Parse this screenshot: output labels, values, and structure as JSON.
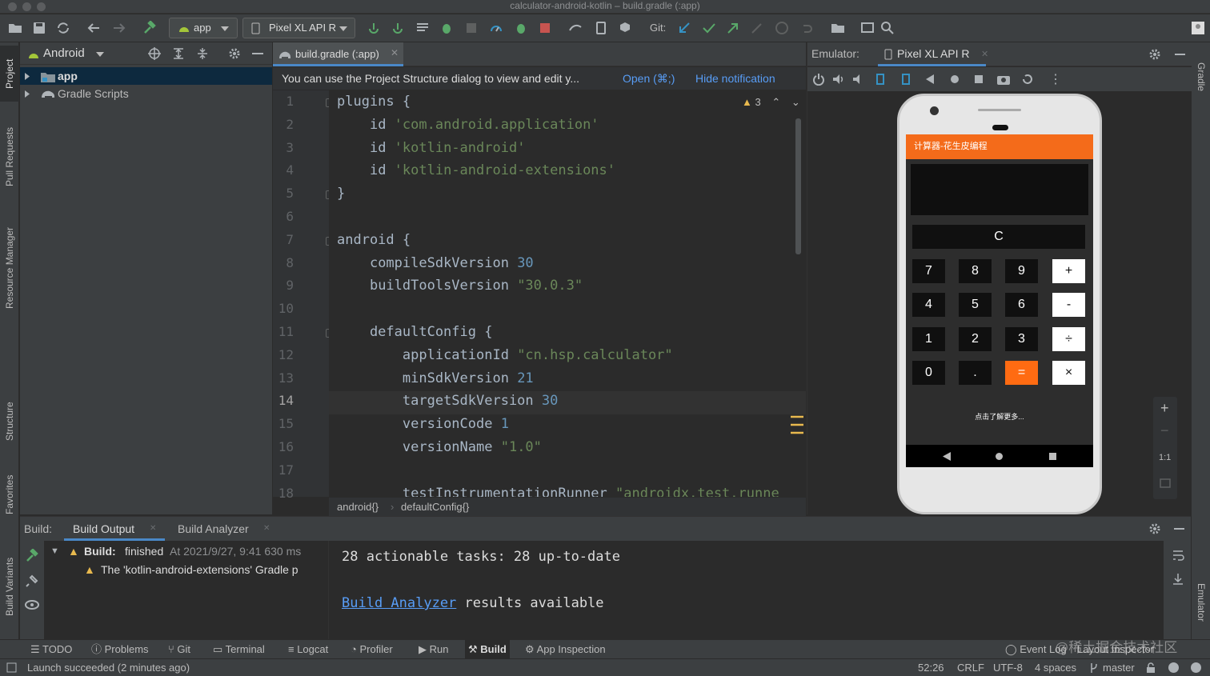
{
  "window": {
    "title": "calculator-android-kotlin – build.gradle (:app)"
  },
  "toolbar": {
    "run_config": "app",
    "device": "Pixel XL API R",
    "git_label": "Git:"
  },
  "project": {
    "view_mode": "Android",
    "tree": [
      {
        "label": "app"
      },
      {
        "label": "Gradle Scripts"
      }
    ]
  },
  "left_strip": [
    "Project",
    "Pull Requests",
    "Resource Manager",
    "Structure",
    "Favorites",
    "Build Variants"
  ],
  "right_strip": [
    "Gradle",
    "Emulator"
  ],
  "editor": {
    "tab": "build.gradle (:app)",
    "notification": "You can use the Project Structure dialog to view and edit y...",
    "notif_open": "Open (⌘;)",
    "notif_hide": "Hide notification",
    "warnings": "3",
    "lines": [
      {
        "n": "1",
        "code": "plugins {"
      },
      {
        "n": "2",
        "indent": "    ",
        "kw": "id ",
        "str": "'com.android.application'"
      },
      {
        "n": "3",
        "indent": "    ",
        "kw": "id ",
        "str": "'kotlin-android'"
      },
      {
        "n": "4",
        "indent": "    ",
        "kw": "id ",
        "str": "'kotlin-android-extensions'"
      },
      {
        "n": "5",
        "code": "}"
      },
      {
        "n": "6",
        "code": ""
      },
      {
        "n": "7",
        "code": "android {"
      },
      {
        "n": "8",
        "indent": "    ",
        "kw": "compileSdkVersion ",
        "num": "30"
      },
      {
        "n": "9",
        "indent": "    ",
        "kw": "buildToolsVersion ",
        "str": "\"30.0.3\""
      },
      {
        "n": "10",
        "code": ""
      },
      {
        "n": "11",
        "code": "    defaultConfig {"
      },
      {
        "n": "12",
        "indent": "        ",
        "kw": "applicationId ",
        "str": "\"cn.hsp.calculator\""
      },
      {
        "n": "13",
        "indent": "        ",
        "kw": "minSdkVersion ",
        "num": "21"
      },
      {
        "n": "14",
        "indent": "        ",
        "kw": "targetSdkVersion ",
        "num": "30"
      },
      {
        "n": "15",
        "indent": "        ",
        "kw": "versionCode ",
        "num": "1"
      },
      {
        "n": "16",
        "indent": "        ",
        "kw": "versionName ",
        "str": "\"1.0\""
      },
      {
        "n": "17",
        "code": ""
      },
      {
        "n": "18",
        "indent": "        ",
        "kw": "testInstrumentationRunner ",
        "str": "\"androidx.test.runne"
      }
    ],
    "breadcrumb": [
      "android{}",
      "defaultConfig{}"
    ]
  },
  "emulator": {
    "label": "Emulator:",
    "device_tab": "Pixel XL API R",
    "zoom_label": "1:1",
    "app": {
      "title": "计算器-花生皮编程",
      "display": "",
      "clear": "C",
      "buttons": [
        [
          "7",
          "8",
          "9",
          "+"
        ],
        [
          "4",
          "5",
          "6",
          "-"
        ],
        [
          "1",
          "2",
          "3",
          "÷"
        ],
        [
          "0",
          ".",
          "=",
          "×"
        ]
      ],
      "more": "点击了解更多..."
    }
  },
  "build": {
    "label": "Build:",
    "tabs": [
      "Build Output",
      "Build Analyzer"
    ],
    "status_bold": "Build:",
    "status_text": "finished",
    "status_time": "At 2021/9/27, 9:41 630 ms",
    "warning": "The 'kotlin-android-extensions' Gradle p",
    "output_line1": "28 actionable tasks: 28 up-to-date",
    "output_link": "Build Analyzer",
    "output_line2_rest": " results available"
  },
  "bottom_tabs": [
    "TODO",
    "Problems",
    "Git",
    "Terminal",
    "Logcat",
    "Profiler",
    "Run",
    "Build",
    "App Inspection"
  ],
  "bottom_right": {
    "event_log": "Event Log",
    "layout_inspector": "Layout Inspector",
    "watermark": "@稀土掘金技术社区"
  },
  "status": {
    "message": "Launch succeeded (2 minutes ago)",
    "position": "52:26",
    "line_sep": "CRLF",
    "encoding": "UTF-8",
    "indent": "4 spaces",
    "branch": "master"
  },
  "colors": {
    "accent": "#ff6b12",
    "link": "#589df6",
    "android_green": "#a4c639"
  }
}
